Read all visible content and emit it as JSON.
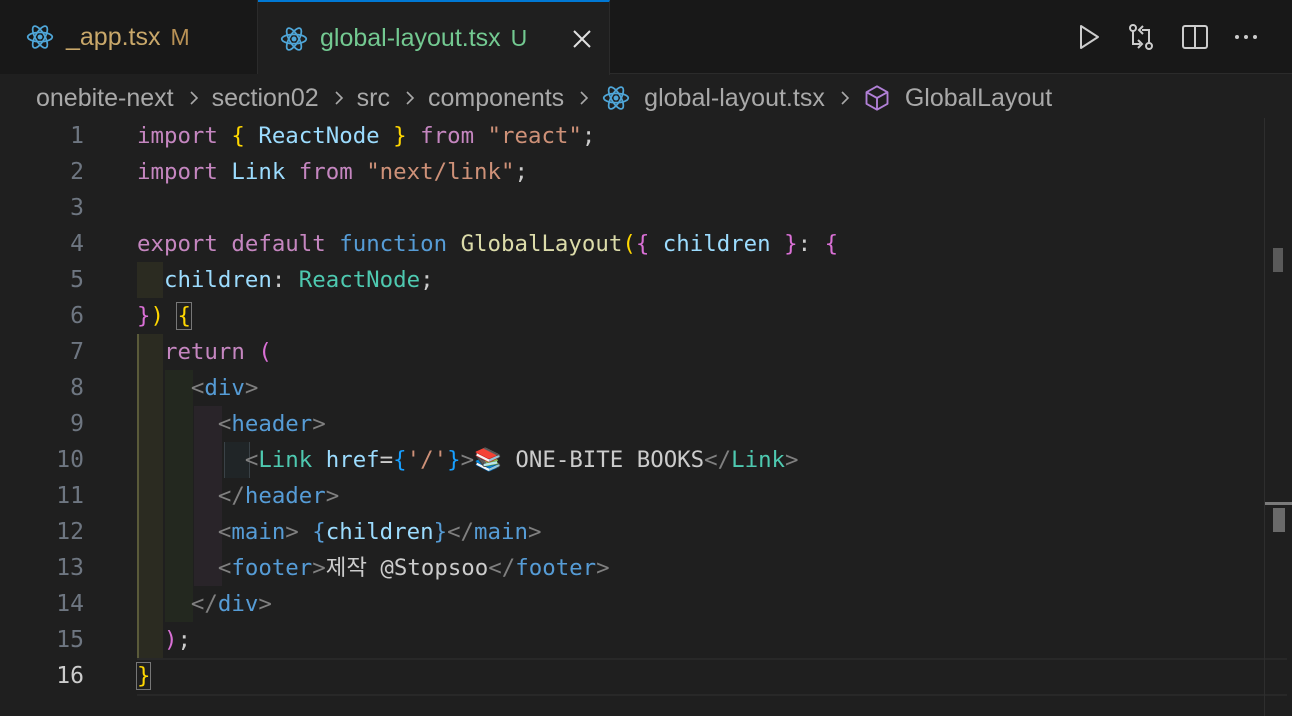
{
  "tabs": [
    {
      "name": "_app.tsx",
      "status": "M"
    },
    {
      "name": "global-layout.tsx",
      "status": "U"
    }
  ],
  "breadcrumb": [
    "onebite-next",
    "section02",
    "src",
    "components",
    "global-layout.tsx",
    "GlobalLayout"
  ],
  "editor": {
    "line_numbers": [
      "1",
      "2",
      "3",
      "4",
      "5",
      "6",
      "7",
      "8",
      "9",
      "10",
      "11",
      "12",
      "13",
      "14",
      "15",
      "16"
    ],
    "active_line": "16",
    "code": {
      "l1": [
        "import",
        "{",
        "ReactNode",
        "}",
        "from",
        "\"react\"",
        ";"
      ],
      "l2": [
        "import",
        "Link",
        "from",
        "\"next/link\"",
        ";"
      ],
      "l4": [
        "export",
        "default",
        "function",
        "GlobalLayout",
        "(",
        "{",
        "children",
        "}",
        ":",
        "{"
      ],
      "l5": [
        "children",
        ":",
        "ReactNode",
        ";"
      ],
      "l6": [
        "}",
        ")",
        "{"
      ],
      "l7": [
        "return",
        "("
      ],
      "l8": [
        "<",
        "div",
        ">"
      ],
      "l9": [
        "<",
        "header",
        ">"
      ],
      "l10": [
        "<",
        "Link",
        "href",
        "=",
        "{",
        "'/'",
        "}",
        ">",
        "📚 ONE-BITE BOOKS",
        "</",
        "Link",
        ">"
      ],
      "l11": [
        "</",
        "header",
        ">"
      ],
      "l12": [
        "<",
        "main",
        ">",
        "{",
        "children",
        "}",
        "</",
        "main",
        ">"
      ],
      "l13": [
        "<",
        "footer",
        ">",
        "제작 @Stopsoo",
        "</",
        "footer",
        ">"
      ],
      "l14": [
        "</",
        "div",
        ">"
      ],
      "l15": [
        ")",
        ";"
      ],
      "l16": [
        "}"
      ]
    }
  },
  "colors": {
    "keyword": "#c586c0",
    "string": "#ce9178",
    "function": "#dcdcaa",
    "variable": "#9cdcfe",
    "type": "#4ec9b0",
    "tag": "#569cd6",
    "tab_accent": "#0078d4"
  },
  "icons": [
    "react-icon",
    "close-icon",
    "run-icon",
    "compare-changes-icon",
    "split-editor-icon",
    "more-actions-icon",
    "chevron-right-icon",
    "symbol-method-icon"
  ]
}
